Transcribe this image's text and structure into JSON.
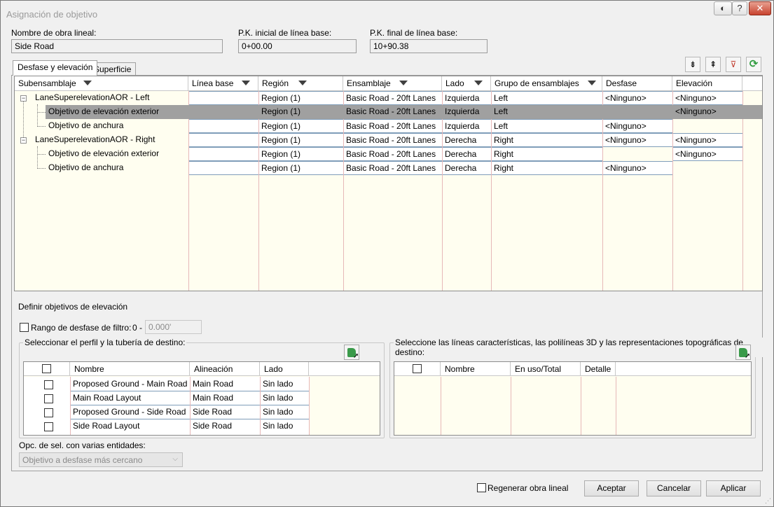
{
  "window": {
    "title": "Asignación de objetivo",
    "help_label": "?",
    "close_label": "✕"
  },
  "header": {
    "name_label": "Nombre de obra lineal:",
    "name_value": "Side Road",
    "start_label": "P.K. inicial de línea base:",
    "start_value": "0+00.00",
    "end_label": "P.K. final de línea base:",
    "end_value": "10+90.38"
  },
  "tabs": [
    {
      "label": "Desfase y elevación",
      "active": true
    },
    {
      "label": "Superficie",
      "active": false
    }
  ],
  "toolbar_icons": [
    "expand-tree-icon",
    "collapse-tree-icon",
    "clear-filter-icon",
    "refresh-icon"
  ],
  "grid": {
    "columns": [
      "Subensamblaje",
      "Línea base",
      "Región",
      "Ensamblaje",
      "Lado",
      "Grupo de ensamblajes",
      "Desfase",
      "Elevación"
    ],
    "rows": [
      {
        "sub": "LaneSuperelevationAOR - Left",
        "level": 0,
        "region": "Region (1)",
        "assembly": "Basic Road - 20ft Lanes",
        "side": "Izquierda",
        "group": "Left",
        "offset": "<Ninguno>",
        "elevation": "<Ninguno>"
      },
      {
        "sub": "Objetivo de elevación exterior",
        "level": 1,
        "region": "Region (1)",
        "assembly": "Basic Road - 20ft Lanes",
        "side": "Izquierda",
        "group": "Left",
        "offset": "",
        "elevation": "<Ninguno>",
        "selected": true
      },
      {
        "sub": "Objetivo de anchura",
        "level": 1,
        "region": "Region (1)",
        "assembly": "Basic Road - 20ft Lanes",
        "side": "Izquierda",
        "group": "Left",
        "offset": "<Ninguno>",
        "elevation": ""
      },
      {
        "sub": "LaneSuperelevationAOR - Right",
        "level": 0,
        "region": "Region (1)",
        "assembly": "Basic Road - 20ft Lanes",
        "side": "Derecha",
        "group": "Right",
        "offset": "<Ninguno>",
        "elevation": "<Ninguno>"
      },
      {
        "sub": "Objetivo de elevación exterior",
        "level": 1,
        "region": "Region (1)",
        "assembly": "Basic Road - 20ft Lanes",
        "side": "Derecha",
        "group": "Right",
        "offset": "",
        "elevation": "<Ninguno>"
      },
      {
        "sub": "Objetivo de anchura",
        "level": 1,
        "region": "Region (1)",
        "assembly": "Basic Road - 20ft Lanes",
        "side": "Derecha",
        "group": "Right",
        "offset": "<Ninguno>",
        "elevation": ""
      }
    ]
  },
  "define_label": "Definir objetivos de elevación",
  "filter": {
    "label": "Rango de desfase de filtro:",
    "from": "0 -",
    "to_value": "0.000'"
  },
  "profile_group": {
    "title": "Seleccionar el perfil y la tubería de destino:",
    "columns": [
      "Nombre",
      "Alineación",
      "Lado"
    ],
    "rows": [
      {
        "name": "Proposed Ground - Main Road",
        "alignment": "Main Road",
        "side": "Sin lado"
      },
      {
        "name": "Main Road Layout",
        "alignment": "Main Road",
        "side": "Sin lado"
      },
      {
        "name": "Proposed Ground - Side Road",
        "alignment": "Side Road",
        "side": "Sin lado"
      },
      {
        "name": "Side Road Layout",
        "alignment": "Side Road",
        "side": "Sin lado"
      }
    ]
  },
  "features_group": {
    "title": "Seleccione las líneas características, las polilíneas 3D y las representaciones topográficas de destino:",
    "columns": [
      "Nombre",
      "En uso/Total",
      "Detalle"
    ]
  },
  "multi_select": {
    "label": "Opc. de sel. con varias entidades:",
    "value": "Objetivo a desfase más cercano"
  },
  "footer": {
    "regen_label": "Regenerar obra lineal",
    "accept": "Aceptar",
    "cancel": "Cancelar",
    "apply": "Aplicar"
  },
  "colors": {
    "grid_bg": "#fffef0",
    "selected_row": "#a0a0a0",
    "column_divider": "#e6b8b8",
    "accent_green": "#3a9a4a"
  }
}
